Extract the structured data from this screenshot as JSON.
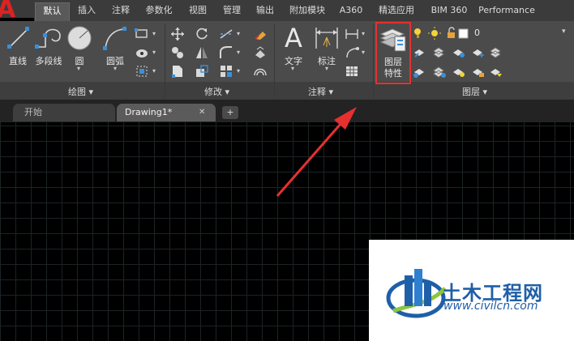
{
  "app": {
    "logo_letter": "A",
    "accent_color": "#d22222"
  },
  "ribbon_tabs": [
    "默认",
    "插入",
    "注释",
    "参数化",
    "视图",
    "管理",
    "输出",
    "附加模块",
    "A360",
    "精选应用",
    "BIM 360",
    "Performance"
  ],
  "active_ribbon_tab": "默认",
  "panels": {
    "draw": {
      "title": "绘图 ▾",
      "buttons": {
        "line": "直线",
        "polyline": "多段线",
        "circle": "圆",
        "arc": "圆弧"
      }
    },
    "modify": {
      "title": "修改 ▾"
    },
    "annotation": {
      "title": "注释 ▾",
      "buttons": {
        "text": "文字",
        "dimension": "标注"
      }
    },
    "layers": {
      "title": "图层 ▾",
      "layer_properties_label_line1": "图层",
      "layer_properties_label_line2": "特性",
      "current_layer": "0",
      "highlight_color": "#e53030"
    }
  },
  "document_tabs": {
    "start_label": "开始",
    "drawing_label": "Drawing1*",
    "close_glyph": "✕",
    "new_tab_glyph": "+"
  },
  "watermark": {
    "title": "土木工程网",
    "url": "www.civilcn.com",
    "title_color": "#1f5fa8"
  },
  "annotation_arrow_color": "#e53030"
}
